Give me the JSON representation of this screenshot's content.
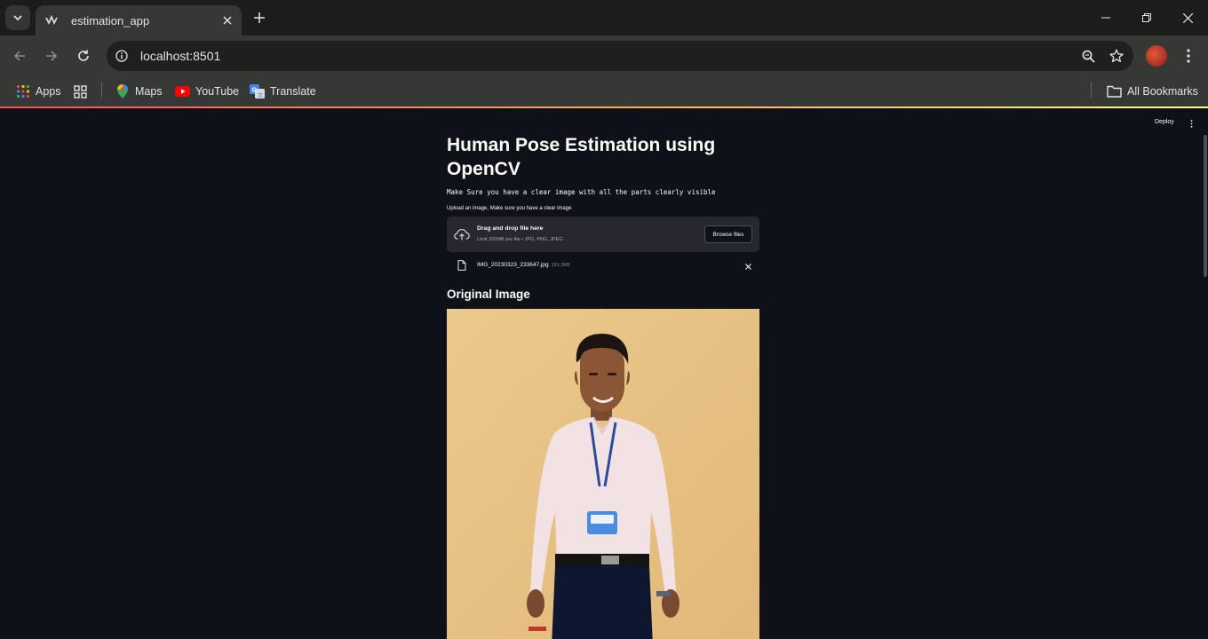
{
  "browser": {
    "tab_title": "estimation_app",
    "url": "localhost:8501",
    "bookmarks": [
      {
        "label": "Apps"
      },
      {
        "label": "Maps"
      },
      {
        "label": "YouTube"
      },
      {
        "label": "Translate"
      }
    ],
    "all_bookmarks_label": "All Bookmarks"
  },
  "app": {
    "deploy_label": "Deploy",
    "title": "Human Pose Estimation using OpenCV",
    "note": "Make Sure you have a clear image with all the parts clearly visible",
    "uploader": {
      "label": "Upload an image, Make sure you have a clear image",
      "drop_title": "Drag and drop file here",
      "drop_hint": "Limit 200MB per file • JPG, PNG, JPEG",
      "browse_label": "Browse files"
    },
    "file": {
      "name": "IMG_20230323_233647.jpg",
      "size": "151.3KB"
    },
    "subheader": "Original Image"
  },
  "colors": {
    "app_bg": "#0e1117",
    "dropzone_bg": "#262730",
    "accent_red": "#ff4b4b",
    "accent_yellow": "#fffd80"
  }
}
